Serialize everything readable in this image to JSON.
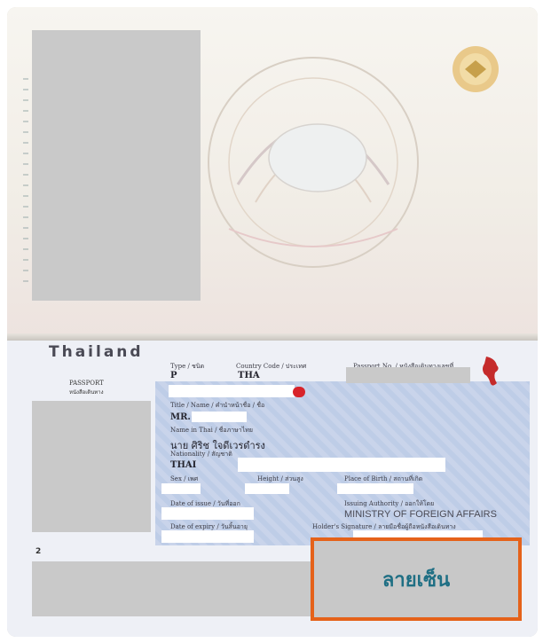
{
  "data_page": {
    "country": "Thailand",
    "document_label": "PASSPORT",
    "document_label_thai": "หนังสือเดินทาง",
    "type_label": "Type / ชนิด",
    "type_value": "P",
    "country_code_label": "Country Code / ประเทศ",
    "country_code_value": "THA",
    "passport_no_label": "Passport No. / หนังสือเดินทางเลขที่",
    "title_name_label": "Title / Name / คำนำหน้าชื่อ / ชื่อ",
    "title_value": "MR.",
    "name_in_thai_label": "Name in Thai / ชื่อภาษาไทย",
    "name_in_thai_value": "นาย ศิริช ใจดีเวรดำรง",
    "nationality_label": "Nationality / สัญชาติ",
    "nationality_value": "THAI",
    "sex_label": "Sex / เพศ",
    "height_label": "Height / ส่วนสูง",
    "place_of_birth_label": "Place of Birth / สถานที่เกิด",
    "date_of_issue_label": "Date of issue / วันที่ออก",
    "issuing_authority_label": "Issuing Authority / ออกให้โดย",
    "issuing_authority_value": "MINISTRY OF FOREIGN AFFAIRS",
    "date_of_expiry_label": "Date of expiry / วันสิ้นอายุ",
    "holder_signature_label": "Holder's Signature / ลายมือชื่อผู้ถือหนังสือเดินทาง",
    "page_number": "2"
  },
  "annotation": {
    "signature_label": "ลายเซ็น",
    "border_color": "#e5621a",
    "text_color": "#1f6f84"
  },
  "icons": [
    "garuda-emblem-icon",
    "royal-seal-icon",
    "thailand-map-icon"
  ]
}
